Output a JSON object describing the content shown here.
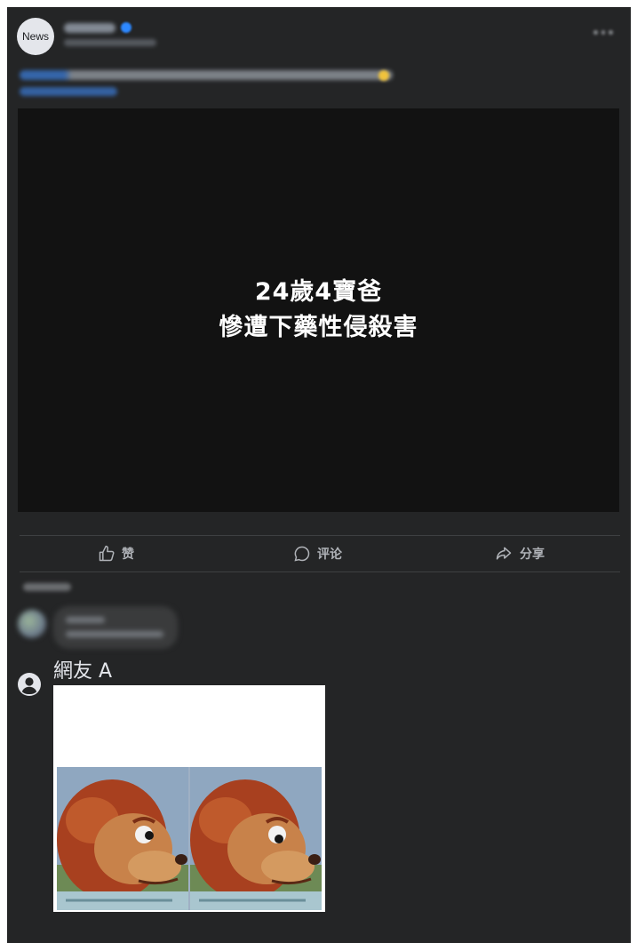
{
  "post": {
    "page_avatar_text": "News",
    "video_title_line1": "24歲4寶爸",
    "video_title_line2": "慘遭下藥性侵殺害"
  },
  "actions": {
    "like": "赞",
    "comment": "评论",
    "share": "分享"
  },
  "comment": {
    "author": "網友 A",
    "image_icon": "monkey-puppet-meme"
  },
  "colors": {
    "card_bg": "#242526",
    "video_bg": "#121212",
    "text_secondary": "#b0b3b8",
    "accent": "#2d88ff"
  }
}
